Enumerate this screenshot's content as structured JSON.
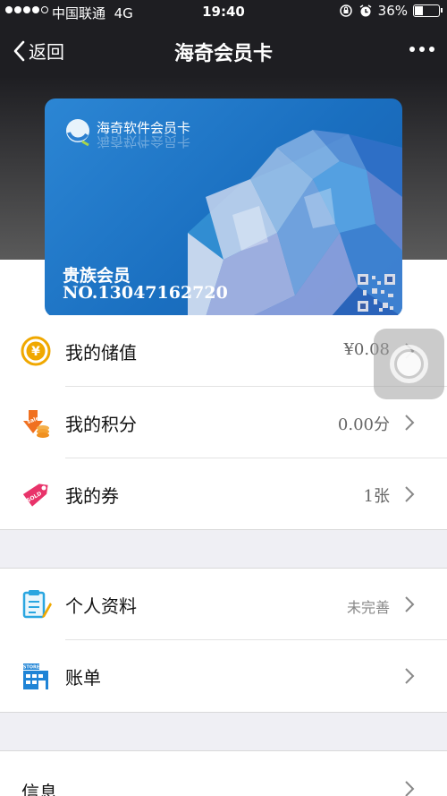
{
  "status_bar": {
    "carrier": "中国联通",
    "network": "4G",
    "time": "19:40",
    "battery_pct": "36%",
    "battery_level": 0.36
  },
  "nav": {
    "back_label": "返回",
    "title": "海奇会员卡"
  },
  "card": {
    "brand": "海奇软件会员卡",
    "level": "贵族会员",
    "number": "NO.13047162720"
  },
  "menu": {
    "group1": [
      {
        "icon": "coin-icon",
        "label": "我的储值",
        "value": "¥0.08"
      },
      {
        "icon": "points-sale-icon",
        "label": "我的积分",
        "value": "0.00分"
      },
      {
        "icon": "coupon-tag-icon",
        "label": "我的券",
        "value": "1张"
      }
    ],
    "group2": [
      {
        "icon": "profile-clipboard-icon",
        "label": "个人资料",
        "value": "未完善"
      },
      {
        "icon": "bill-store-icon",
        "label": "账单",
        "value": ""
      }
    ],
    "group3": [
      {
        "label": "信息",
        "value": ""
      }
    ]
  },
  "colors": {
    "nav_bg": "#1e1e22",
    "card_blue": "#1a6fc0",
    "coin": "#f0a800",
    "points": "#f07020",
    "coupon": "#e8336a",
    "profile": "#2aa6e0"
  }
}
